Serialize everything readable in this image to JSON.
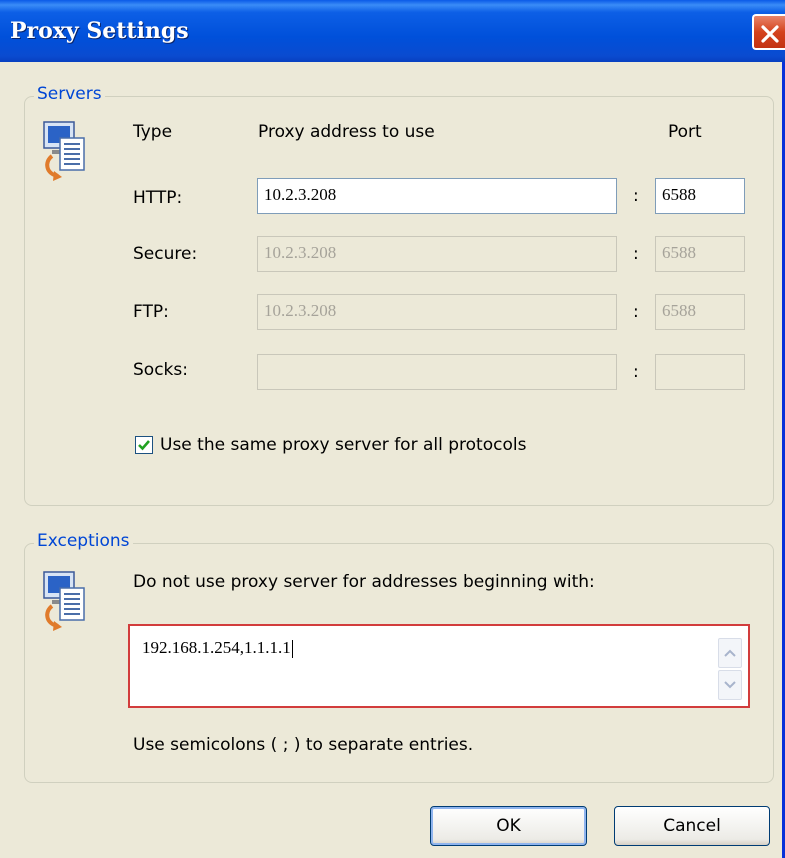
{
  "window": {
    "title": "Proxy Settings"
  },
  "servers": {
    "legend": "Servers",
    "headers": {
      "type": "Type",
      "address": "Proxy address to use",
      "port": "Port"
    },
    "rows": [
      {
        "label": "HTTP:",
        "address": "10.2.3.208",
        "port": "6588",
        "enabled": true
      },
      {
        "label": "Secure:",
        "address": "10.2.3.208",
        "port": "6588",
        "enabled": false
      },
      {
        "label": "FTP:",
        "address": "10.2.3.208",
        "port": "6588",
        "enabled": false
      },
      {
        "label": "Socks:",
        "address": "",
        "port": "",
        "enabled": false
      }
    ],
    "separator": ":",
    "same_proxy": {
      "label": "Use the same proxy server for all protocols",
      "checked": true
    }
  },
  "exceptions": {
    "legend": "Exceptions",
    "description": "Do not use proxy server for addresses beginning with:",
    "value": "192.168.1.254,1.1.1.1",
    "hint": "Use semicolons ( ; ) to separate entries."
  },
  "buttons": {
    "ok": "OK",
    "cancel": "Cancel"
  },
  "colors": {
    "title_bar": "#0054e3",
    "close_button": "#d4431d",
    "group_legend": "#0046d5",
    "textarea_border": "#d23c3c"
  }
}
